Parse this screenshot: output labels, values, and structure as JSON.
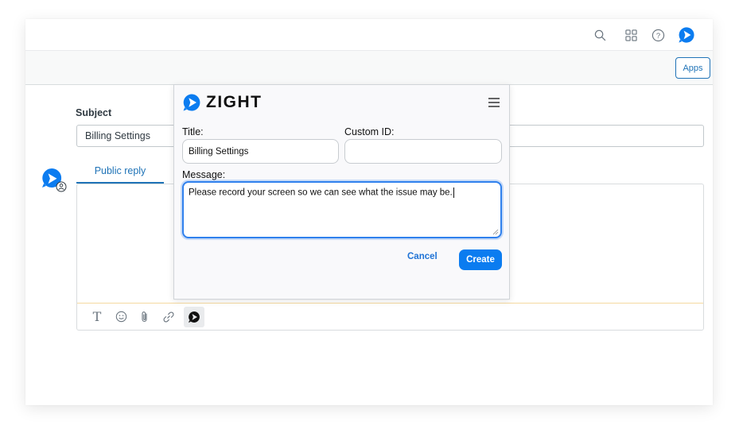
{
  "header": {
    "icons": [
      "search-icon",
      "grid-icon",
      "help-icon",
      "zight-icon"
    ]
  },
  "subbar": {
    "apps_label": "Apps"
  },
  "ticket": {
    "subject_label": "Subject",
    "subject_value": "Billing Settings",
    "reply_tab_label": "Public reply"
  },
  "editor_toolbar": {
    "text_tool": "T",
    "icons": [
      "text-format-icon",
      "emoji-icon",
      "attachment-icon",
      "link-icon",
      "zight-icon"
    ]
  },
  "zight_modal": {
    "logo_text": "ZIGHT",
    "title_label": "Title:",
    "title_value": "Billing Settings",
    "custom_id_label": "Custom ID:",
    "custom_id_value": "",
    "message_label": "Message:",
    "message_value": "Please record your screen so we can see what the issue may be.",
    "cancel_label": "Cancel",
    "create_label": "Create"
  },
  "colors": {
    "brand_blue": "#1f73b7",
    "zight_blue": "#0b7cf0",
    "focus_blue": "#2f80ed"
  }
}
